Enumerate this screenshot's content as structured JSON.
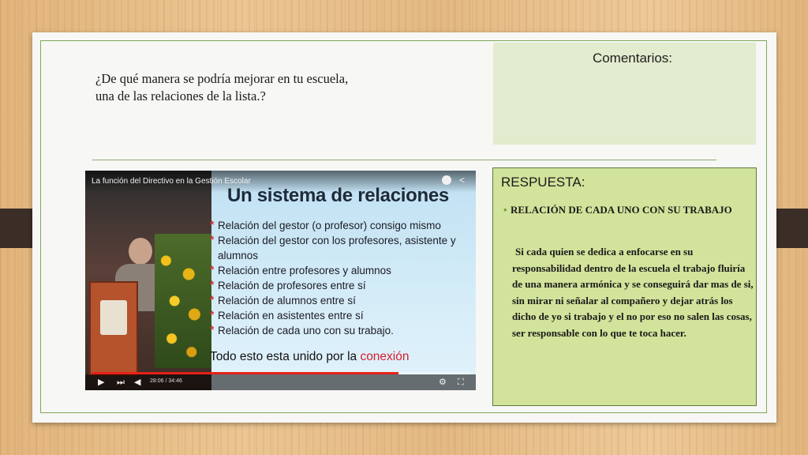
{
  "question": {
    "line1": "¿De qué manera se podría mejorar en tu escuela,",
    "line2": "una de las relaciones de la lista.?"
  },
  "comments": {
    "title": "Comentarios:"
  },
  "video": {
    "title": "La función del Directivo en la Gestión Escolar",
    "heading": "Un sistema de relaciones",
    "bullets": [
      "Relación del gestor (o profesor) consigo mismo",
      "Relación del gestor con los profesores, asistente y alumnos",
      "Relación entre profesores y alumnos",
      "Relación de profesores entre sí",
      "Relación de alumnos entre sí",
      "Relación en asistentes entre sí",
      "Relación de cada uno con su trabajo."
    ],
    "footer_prefix": "Todo esto esta unido por la ",
    "footer_highlight": "conexión",
    "time": "28:06 / 34:46",
    "progress": 0.81,
    "icons": [
      "clock-icon",
      "share-icon",
      "play-icon",
      "next-icon",
      "volume-icon",
      "gear-icon",
      "fullscreen-icon"
    ]
  },
  "answer": {
    "title": "RESPUESTA:",
    "subhead": "RELACIÓN DE CADA UNO CON SU TRABAJO",
    "body": "Si cada quien se dedica a enfocarse en su responsabilidad dentro de la escuela el trabajo fluiría de una manera armónica y se conseguirá dar mas de si, sin mirar ni señalar al compañero y dejar atrás los dicho de yo si trabajo y el no por eso no salen las cosas, ser responsable con lo que te toca hacer."
  },
  "colors": {
    "frame": "#7fa85a",
    "comments_bg": "#e2ecce",
    "answer_bg": "#d2e39b",
    "highlight": "#d41f2d"
  }
}
